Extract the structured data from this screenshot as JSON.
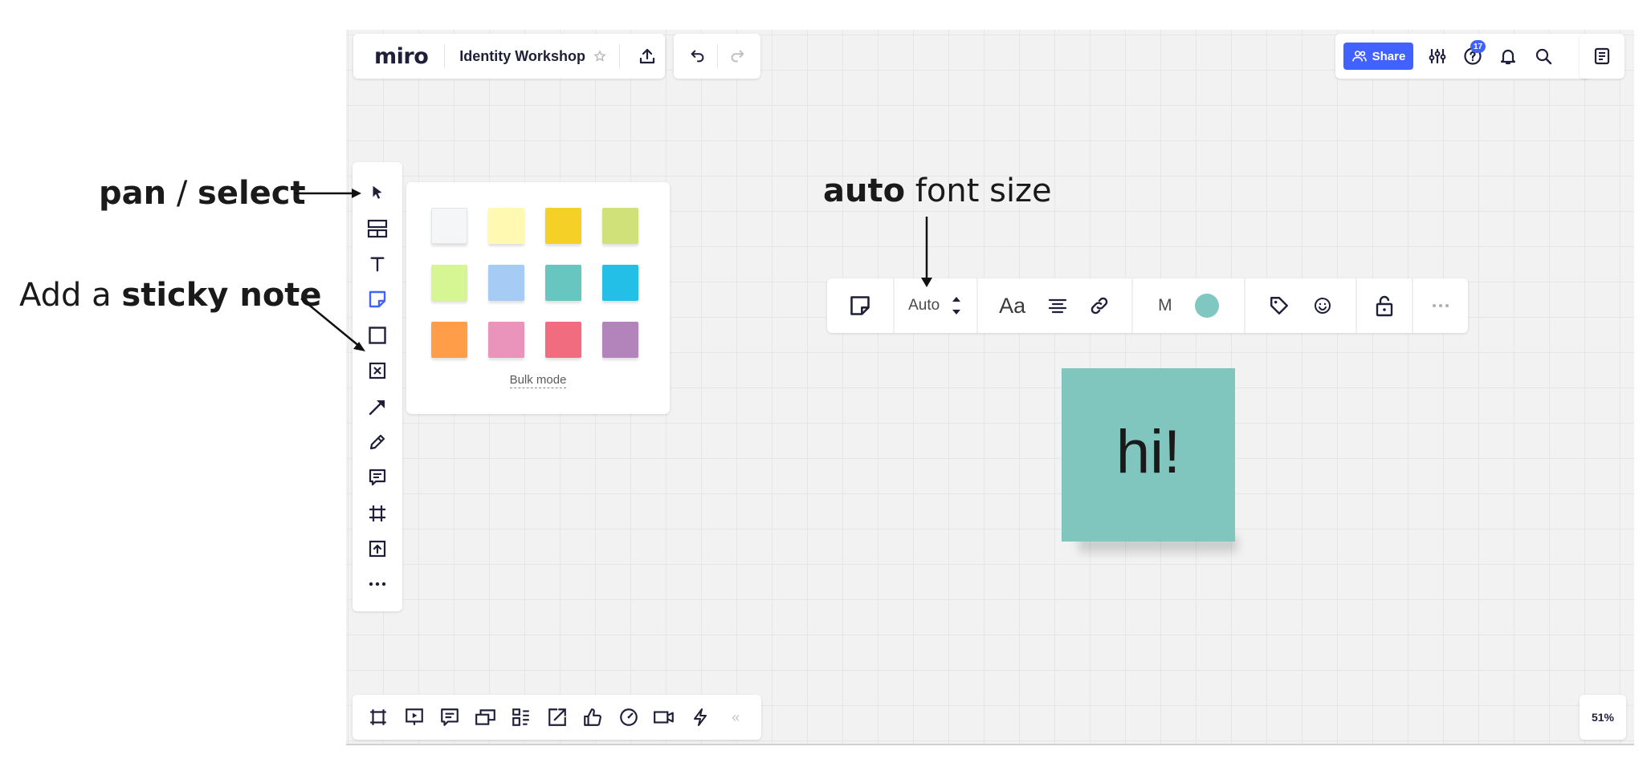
{
  "app": {
    "logo": "miro",
    "board_title": "Identity Workshop"
  },
  "top_bar": {
    "share_label": "Share",
    "help_badge_count": "17",
    "icons": [
      "star-icon",
      "export-icon",
      "undo-icon",
      "redo-icon",
      "settings-sliders-icon",
      "help-icon",
      "bell-icon",
      "search-icon",
      "notes-icon"
    ]
  },
  "left_toolbar": {
    "tools": [
      "select-cursor-icon",
      "templates-icon",
      "text-icon",
      "sticky-note-icon",
      "shape-icon",
      "card-icon",
      "connection-line-icon",
      "pen-icon",
      "comment-icon",
      "frame-icon",
      "upload-icon",
      "more-icon"
    ],
    "active_tool": "sticky-note-icon"
  },
  "sticky_palette": {
    "colors": [
      "#f5f6f8",
      "#fff9b1",
      "#f5d128",
      "#d0e17a",
      "#d5f692",
      "#a6ccf5",
      "#67c6c0",
      "#23bfe7",
      "#ff9d48",
      "#ea94bb",
      "#f16c7f",
      "#b384bb"
    ],
    "bulk_mode_label": "Bulk mode"
  },
  "context_toolbar": {
    "font_size": "Auto",
    "font_label": "Aa",
    "author_initial": "M",
    "current_color": "#7fc7c0"
  },
  "sticky_note": {
    "text": "hi!",
    "color": "#80c6bf"
  },
  "bottom_bar": {
    "icons": [
      "frames-icon",
      "presentation-icon",
      "comments-icon",
      "cards-icon",
      "kanban-icon",
      "share-screen-icon",
      "voting-icon",
      "timer-icon",
      "video-icon",
      "lightning-icon"
    ],
    "collapse_label": "«"
  },
  "zoom": {
    "level": "51%"
  },
  "annotations": {
    "pan_bold_1": "pan",
    "pan_sep": " / ",
    "pan_bold_2": "select",
    "sticky_prefix": "Add a ",
    "sticky_bold": "sticky note",
    "auto_bold": "auto",
    "auto_rest": " font size"
  }
}
